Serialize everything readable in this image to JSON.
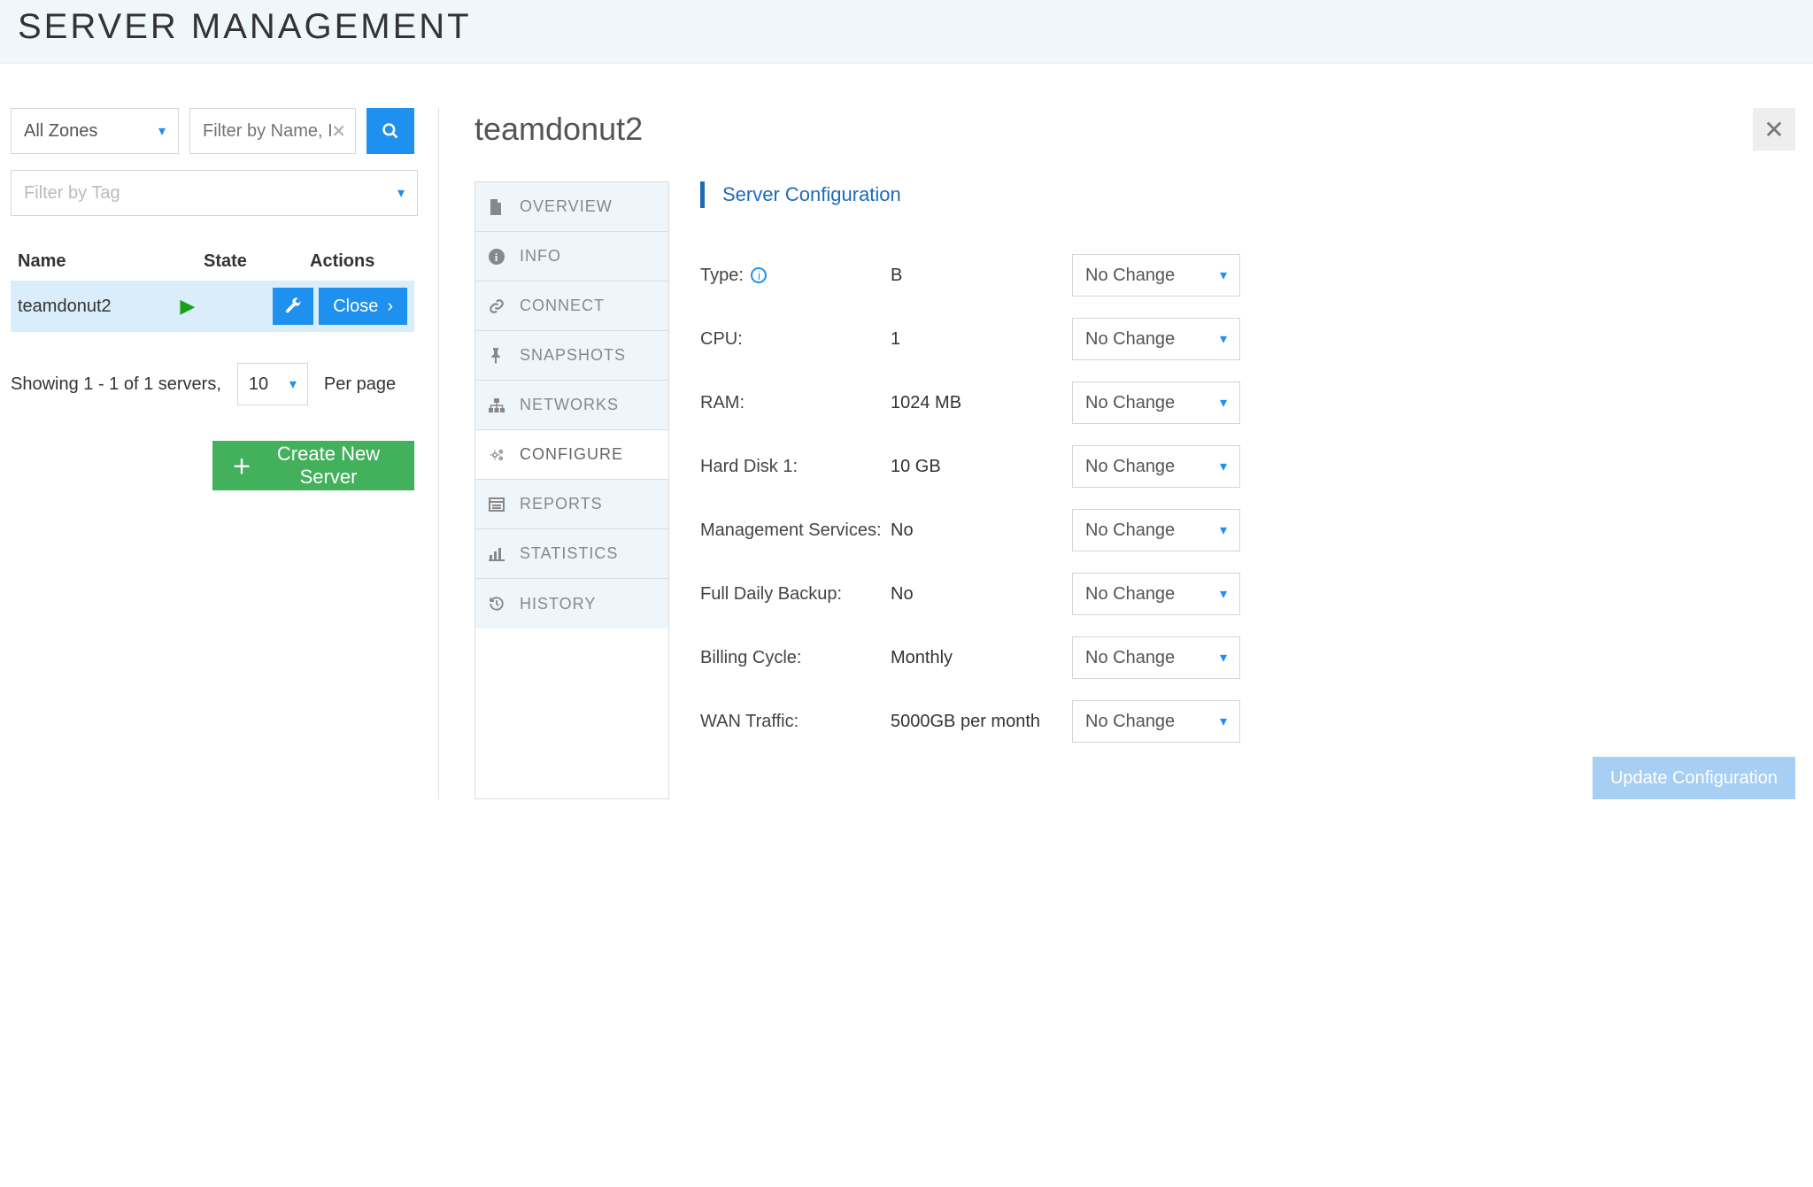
{
  "header": {
    "title": "SERVER MANAGEMENT"
  },
  "filters": {
    "zone_selected": "All Zones",
    "name_placeholder": "Filter by Name, IP",
    "tag_placeholder": "Filter by Tag"
  },
  "table": {
    "headers": {
      "name": "Name",
      "state": "State",
      "actions": "Actions"
    },
    "rows": [
      {
        "name": "teamdonut2",
        "state_icon": "play",
        "close_label": "Close"
      }
    ]
  },
  "pager": {
    "showing_text": "Showing 1 - 1 of 1 servers,",
    "per_page_value": "10",
    "per_page_label": "Per page"
  },
  "create_button": "Create New Server",
  "detail": {
    "title": "teamdonut2",
    "tabs": [
      {
        "label": "OVERVIEW",
        "icon": "file"
      },
      {
        "label": "INFO",
        "icon": "info"
      },
      {
        "label": "CONNECT",
        "icon": "link"
      },
      {
        "label": "SNAPSHOTS",
        "icon": "pin"
      },
      {
        "label": "NETWORKS",
        "icon": "sitemap"
      },
      {
        "label": "CONFIGURE",
        "icon": "cogs",
        "active": true
      },
      {
        "label": "REPORTS",
        "icon": "report"
      },
      {
        "label": "STATISTICS",
        "icon": "stats"
      },
      {
        "label": "HISTORY",
        "icon": "history"
      }
    ],
    "panel_title": "Server Configuration",
    "config": [
      {
        "label": "Type:",
        "info": true,
        "value": "B",
        "select": "No Change"
      },
      {
        "label": "CPU:",
        "value": "1",
        "select": "No Change"
      },
      {
        "label": "RAM:",
        "value": "1024 MB",
        "select": "No Change"
      },
      {
        "label": "Hard Disk 1:",
        "value": "10 GB",
        "select": "No Change"
      },
      {
        "label": "Management Services:",
        "value": "No",
        "select": "No Change"
      },
      {
        "label": "Full Daily Backup:",
        "value": "No",
        "select": "No Change"
      },
      {
        "label": "Billing Cycle:",
        "value": "Monthly",
        "select": "No Change"
      },
      {
        "label": "WAN Traffic:",
        "value": "5000GB per month",
        "select": "No Change"
      }
    ],
    "update_button": "Update Configuration"
  }
}
